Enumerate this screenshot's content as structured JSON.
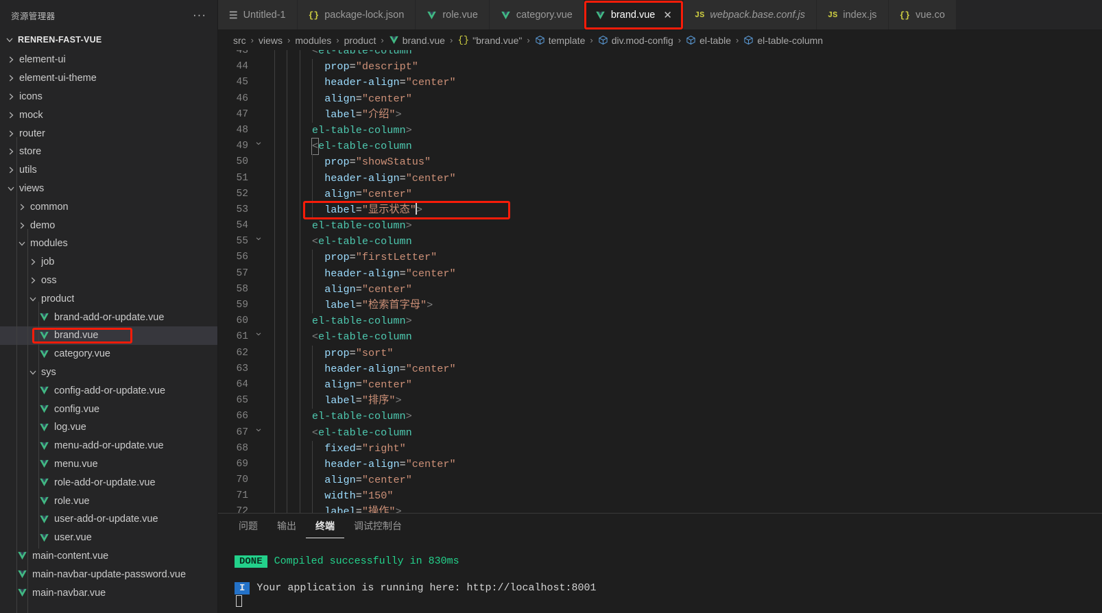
{
  "sidebar": {
    "header_title": "资源管理器",
    "more_actions": "···",
    "root_label": "RENREN-FAST-VUE",
    "items": [
      {
        "label": "element-ui",
        "type": "folder",
        "indent": 1,
        "expanded": false
      },
      {
        "label": "element-ui-theme",
        "type": "folder",
        "indent": 1,
        "expanded": false
      },
      {
        "label": "icons",
        "type": "folder",
        "indent": 1,
        "expanded": false
      },
      {
        "label": "mock",
        "type": "folder",
        "indent": 1,
        "expanded": false
      },
      {
        "label": "router",
        "type": "folder",
        "indent": 1,
        "expanded": false
      },
      {
        "label": "store",
        "type": "folder",
        "indent": 1,
        "expanded": false
      },
      {
        "label": "utils",
        "type": "folder",
        "indent": 1,
        "expanded": false
      },
      {
        "label": "views",
        "type": "folder",
        "indent": 1,
        "expanded": true
      },
      {
        "label": "common",
        "type": "folder",
        "indent": 2,
        "expanded": false
      },
      {
        "label": "demo",
        "type": "folder",
        "indent": 2,
        "expanded": false
      },
      {
        "label": "modules",
        "type": "folder",
        "indent": 2,
        "expanded": true
      },
      {
        "label": "job",
        "type": "folder",
        "indent": 3,
        "expanded": false
      },
      {
        "label": "oss",
        "type": "folder",
        "indent": 3,
        "expanded": false
      },
      {
        "label": "product",
        "type": "folder",
        "indent": 3,
        "expanded": true
      },
      {
        "label": "brand-add-or-update.vue",
        "type": "vue",
        "indent": 4,
        "selected": false
      },
      {
        "label": "brand.vue",
        "type": "vue",
        "indent": 4,
        "selected": true,
        "annotated": true
      },
      {
        "label": "category.vue",
        "type": "vue",
        "indent": 4,
        "selected": false
      },
      {
        "label": "sys",
        "type": "folder",
        "indent": 3,
        "expanded": true
      },
      {
        "label": "config-add-or-update.vue",
        "type": "vue",
        "indent": 4
      },
      {
        "label": "config.vue",
        "type": "vue",
        "indent": 4
      },
      {
        "label": "log.vue",
        "type": "vue",
        "indent": 4
      },
      {
        "label": "menu-add-or-update.vue",
        "type": "vue",
        "indent": 4
      },
      {
        "label": "menu.vue",
        "type": "vue",
        "indent": 4
      },
      {
        "label": "role-add-or-update.vue",
        "type": "vue",
        "indent": 4
      },
      {
        "label": "role.vue",
        "type": "vue",
        "indent": 4
      },
      {
        "label": "user-add-or-update.vue",
        "type": "vue",
        "indent": 4
      },
      {
        "label": "user.vue",
        "type": "vue",
        "indent": 4
      },
      {
        "label": "main-content.vue",
        "type": "vue",
        "indent": 2
      },
      {
        "label": "main-navbar-update-password.vue",
        "type": "vue",
        "indent": 2
      },
      {
        "label": "main-navbar.vue",
        "type": "vue",
        "indent": 2
      }
    ]
  },
  "tabs": [
    {
      "label": "Untitled-1",
      "icon": "text-file-icon",
      "active": false,
      "preview": false,
      "dirty": false
    },
    {
      "label": "package-lock.json",
      "icon": "json-file-icon",
      "active": false,
      "preview": false
    },
    {
      "label": "role.vue",
      "icon": "vue-file-icon",
      "active": false,
      "preview": false
    },
    {
      "label": "category.vue",
      "icon": "vue-file-icon",
      "active": false,
      "preview": false
    },
    {
      "label": "brand.vue",
      "icon": "vue-file-icon",
      "active": true,
      "preview": false,
      "close_glyph": "✕",
      "annotated": true
    },
    {
      "label": "webpack.base.conf.js",
      "icon": "js-file-icon",
      "active": false,
      "preview": true
    },
    {
      "label": "index.js",
      "icon": "js-file-icon",
      "active": false,
      "preview": false
    },
    {
      "label": "vue.co",
      "icon": "json-file-icon",
      "active": false,
      "preview": false
    }
  ],
  "breadcrumb": {
    "separator": "›",
    "items": [
      {
        "label": "src",
        "icon": "none"
      },
      {
        "label": "views",
        "icon": "none"
      },
      {
        "label": "modules",
        "icon": "none"
      },
      {
        "label": "product",
        "icon": "none"
      },
      {
        "label": "brand.vue",
        "icon": "vue-file-icon"
      },
      {
        "label": "\"brand.vue\"",
        "icon": "json-symbol-icon"
      },
      {
        "label": "template",
        "icon": "cube-symbol-icon"
      },
      {
        "label": "div.mod-config",
        "icon": "cube-symbol-icon"
      },
      {
        "label": "el-table",
        "icon": "cube-symbol-icon"
      },
      {
        "label": "el-table-column",
        "icon": "cube-symbol-icon"
      }
    ]
  },
  "editor": {
    "first_visible_line": 43,
    "cursor_line": 53,
    "lines": [
      {
        "n": 43,
        "fold": "open",
        "indent": 3,
        "partial_top": true,
        "tokens": [
          {
            "t": "brk",
            "v": "<"
          },
          {
            "t": "tagname",
            "v": "el-table-column"
          }
        ]
      },
      {
        "n": 44,
        "indent": 4,
        "tokens": [
          {
            "t": "attr",
            "v": "prop"
          },
          {
            "t": "eq",
            "v": "="
          },
          {
            "t": "str",
            "v": "\"descript\""
          }
        ]
      },
      {
        "n": 45,
        "indent": 4,
        "tokens": [
          {
            "t": "attr",
            "v": "header-align"
          },
          {
            "t": "eq",
            "v": "="
          },
          {
            "t": "str",
            "v": "\"center\""
          }
        ]
      },
      {
        "n": 46,
        "indent": 4,
        "tokens": [
          {
            "t": "attr",
            "v": "align"
          },
          {
            "t": "eq",
            "v": "="
          },
          {
            "t": "str",
            "v": "\"center\""
          }
        ]
      },
      {
        "n": 47,
        "indent": 4,
        "tokens": [
          {
            "t": "attr",
            "v": "label"
          },
          {
            "t": "eq",
            "v": "="
          },
          {
            "t": "str",
            "v": "\"介绍\""
          },
          {
            "t": "brk",
            "v": ">"
          }
        ]
      },
      {
        "n": 48,
        "indent": 3,
        "tokens": [
          {
            "t": "brk",
            "v": "</"
          },
          {
            "t": "tagname",
            "v": "el-table-column"
          },
          {
            "t": "brk",
            "v": ">"
          }
        ]
      },
      {
        "n": 49,
        "fold": "open",
        "indent": 3,
        "match_first": true,
        "tokens": [
          {
            "t": "brk",
            "v": "<"
          },
          {
            "t": "tagname",
            "v": "el-table-column"
          }
        ]
      },
      {
        "n": 50,
        "indent": 4,
        "tokens": [
          {
            "t": "attr",
            "v": "prop"
          },
          {
            "t": "eq",
            "v": "="
          },
          {
            "t": "str",
            "v": "\"showStatus\""
          }
        ]
      },
      {
        "n": 51,
        "indent": 4,
        "tokens": [
          {
            "t": "attr",
            "v": "header-align"
          },
          {
            "t": "eq",
            "v": "="
          },
          {
            "t": "str",
            "v": "\"center\""
          }
        ]
      },
      {
        "n": 52,
        "indent": 4,
        "tokens": [
          {
            "t": "attr",
            "v": "align"
          },
          {
            "t": "eq",
            "v": "="
          },
          {
            "t": "str",
            "v": "\"center\""
          }
        ]
      },
      {
        "n": 53,
        "indent": 4,
        "annotated": true,
        "cursor_after": 2,
        "tokens": [
          {
            "t": "attr",
            "v": "label"
          },
          {
            "t": "eq",
            "v": "="
          },
          {
            "t": "str",
            "v": "\"显示状态\""
          },
          {
            "t": "brk",
            "v": ">"
          }
        ]
      },
      {
        "n": 54,
        "indent": 3,
        "tokens": [
          {
            "t": "brk",
            "v": "</"
          },
          {
            "t": "tagname",
            "v": "el-table-column"
          },
          {
            "t": "brk",
            "v": ">"
          }
        ]
      },
      {
        "n": 55,
        "fold": "open",
        "indent": 3,
        "tokens": [
          {
            "t": "brk",
            "v": "<"
          },
          {
            "t": "tagname",
            "v": "el-table-column"
          }
        ]
      },
      {
        "n": 56,
        "indent": 4,
        "tokens": [
          {
            "t": "attr",
            "v": "prop"
          },
          {
            "t": "eq",
            "v": "="
          },
          {
            "t": "str",
            "v": "\"firstLetter\""
          }
        ]
      },
      {
        "n": 57,
        "indent": 4,
        "tokens": [
          {
            "t": "attr",
            "v": "header-align"
          },
          {
            "t": "eq",
            "v": "="
          },
          {
            "t": "str",
            "v": "\"center\""
          }
        ]
      },
      {
        "n": 58,
        "indent": 4,
        "tokens": [
          {
            "t": "attr",
            "v": "align"
          },
          {
            "t": "eq",
            "v": "="
          },
          {
            "t": "str",
            "v": "\"center\""
          }
        ]
      },
      {
        "n": 59,
        "indent": 4,
        "tokens": [
          {
            "t": "attr",
            "v": "label"
          },
          {
            "t": "eq",
            "v": "="
          },
          {
            "t": "str",
            "v": "\"检索首字母\""
          },
          {
            "t": "brk",
            "v": ">"
          }
        ]
      },
      {
        "n": 60,
        "indent": 3,
        "tokens": [
          {
            "t": "brk",
            "v": "</"
          },
          {
            "t": "tagname",
            "v": "el-table-column"
          },
          {
            "t": "brk",
            "v": ">"
          }
        ]
      },
      {
        "n": 61,
        "fold": "open",
        "indent": 3,
        "tokens": [
          {
            "t": "brk",
            "v": "<"
          },
          {
            "t": "tagname",
            "v": "el-table-column"
          }
        ]
      },
      {
        "n": 62,
        "indent": 4,
        "tokens": [
          {
            "t": "attr",
            "v": "prop"
          },
          {
            "t": "eq",
            "v": "="
          },
          {
            "t": "str",
            "v": "\"sort\""
          }
        ]
      },
      {
        "n": 63,
        "indent": 4,
        "tokens": [
          {
            "t": "attr",
            "v": "header-align"
          },
          {
            "t": "eq",
            "v": "="
          },
          {
            "t": "str",
            "v": "\"center\""
          }
        ]
      },
      {
        "n": 64,
        "indent": 4,
        "tokens": [
          {
            "t": "attr",
            "v": "align"
          },
          {
            "t": "eq",
            "v": "="
          },
          {
            "t": "str",
            "v": "\"center\""
          }
        ]
      },
      {
        "n": 65,
        "indent": 4,
        "tokens": [
          {
            "t": "attr",
            "v": "label"
          },
          {
            "t": "eq",
            "v": "="
          },
          {
            "t": "str",
            "v": "\"排序\""
          },
          {
            "t": "brk",
            "v": ">"
          }
        ]
      },
      {
        "n": 66,
        "indent": 3,
        "tokens": [
          {
            "t": "brk",
            "v": "</"
          },
          {
            "t": "tagname",
            "v": "el-table-column"
          },
          {
            "t": "brk",
            "v": ">"
          }
        ]
      },
      {
        "n": 67,
        "fold": "open",
        "indent": 3,
        "tokens": [
          {
            "t": "brk",
            "v": "<"
          },
          {
            "t": "tagname",
            "v": "el-table-column"
          }
        ]
      },
      {
        "n": 68,
        "indent": 4,
        "tokens": [
          {
            "t": "attr",
            "v": "fixed"
          },
          {
            "t": "eq",
            "v": "="
          },
          {
            "t": "str",
            "v": "\"right\""
          }
        ]
      },
      {
        "n": 69,
        "indent": 4,
        "tokens": [
          {
            "t": "attr",
            "v": "header-align"
          },
          {
            "t": "eq",
            "v": "="
          },
          {
            "t": "str",
            "v": "\"center\""
          }
        ]
      },
      {
        "n": 70,
        "indent": 4,
        "tokens": [
          {
            "t": "attr",
            "v": "align"
          },
          {
            "t": "eq",
            "v": "="
          },
          {
            "t": "str",
            "v": "\"center\""
          }
        ]
      },
      {
        "n": 71,
        "indent": 4,
        "tokens": [
          {
            "t": "attr",
            "v": "width"
          },
          {
            "t": "eq",
            "v": "="
          },
          {
            "t": "str",
            "v": "\"150\""
          }
        ]
      },
      {
        "n": 72,
        "indent": 4,
        "clipped": true,
        "tokens": [
          {
            "t": "attr",
            "v": "label"
          },
          {
            "t": "eq",
            "v": "="
          },
          {
            "t": "str",
            "v": "\"操作\""
          },
          {
            "t": "brk",
            "v": ">"
          }
        ]
      }
    ]
  },
  "panel": {
    "tabs": [
      {
        "label": "问题",
        "active": false
      },
      {
        "label": "输出",
        "active": false
      },
      {
        "label": "终端",
        "active": true
      },
      {
        "label": "调试控制台",
        "active": false
      }
    ],
    "terminal_lines": [
      {
        "badge": "DONE",
        "badge_kind": "done",
        "text": "Compiled successfully in 830ms"
      },
      {
        "badge": "I",
        "badge_kind": "info",
        "text": "Your application is running here: http://localhost:8001"
      }
    ]
  },
  "colors": {
    "annotation_red": "#f81c09",
    "vue_green": "#41b883",
    "accent_blue": "#2472c8",
    "terminal_green": "#23d18b",
    "editor_bg": "#1e1e1e",
    "sidebar_bg": "#252526",
    "tab_inactive_bg": "#2d2d2d",
    "selection_bg": "#37373d"
  }
}
